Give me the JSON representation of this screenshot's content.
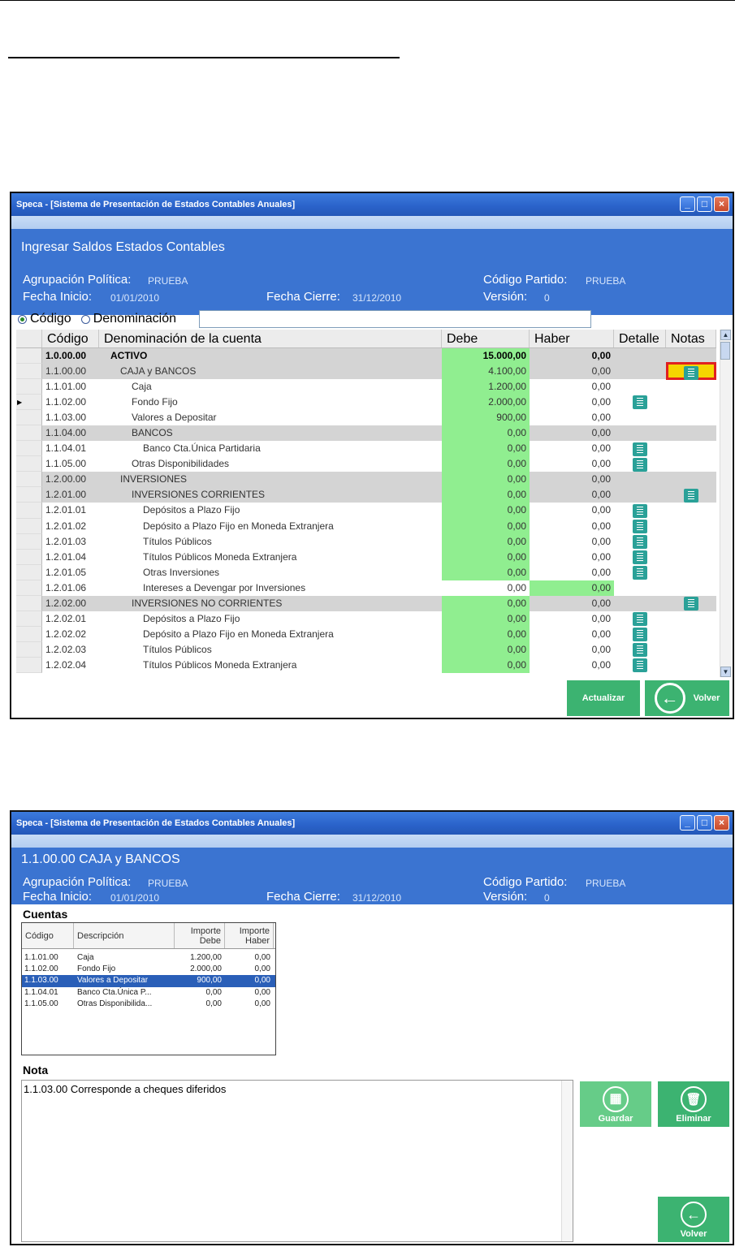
{
  "window1": {
    "title": "Speca - [Sistema de Presentación de Estados Contables Anuales]",
    "header_title": "Ingresar Saldos Estados Contables",
    "agrupacion_label": "Agrupación Política:",
    "agrupacion_value": "PRUEBA",
    "codigo_partido_label": "Código Partido:",
    "codigo_partido_value": "PRUEBA",
    "fecha_inicio_label": "Fecha Inicio:",
    "fecha_inicio_value": "01/01/2010",
    "fecha_cierre_label": "Fecha Cierre:",
    "fecha_cierre_value": "31/12/2010",
    "version_label": "Versión:",
    "version_value": "0",
    "radio_codigo": "Código",
    "radio_denominacion": "Denominación",
    "columns": [
      "Código",
      "Denominación de la cuenta",
      "Debe",
      "Haber",
      "Detalle",
      "Notas"
    ],
    "rows": [
      {
        "codigo": "1.0.00.00",
        "denominacion": "ACTIVO",
        "debe": "15.000,00",
        "haber": "0,00"
      },
      {
        "codigo": "1.1.00.00",
        "denominacion": "CAJA y BANCOS",
        "debe": "4.100,00",
        "haber": "0,00"
      },
      {
        "codigo": "1.1.01.00",
        "denominacion": "Caja",
        "debe": "1.200,00",
        "haber": "0,00"
      },
      {
        "codigo": "1.1.02.00",
        "denominacion": "Fondo Fijo",
        "debe": "2.000,00",
        "haber": "0,00"
      },
      {
        "codigo": "1.1.03.00",
        "denominacion": "Valores a Depositar",
        "debe": "900,00",
        "haber": "0,00"
      },
      {
        "codigo": "1.1.04.00",
        "denominacion": "BANCOS",
        "debe": "0,00",
        "haber": "0,00"
      },
      {
        "codigo": "1.1.04.01",
        "denominacion": "Banco Cta.Única Partidaria",
        "debe": "0,00",
        "haber": "0,00"
      },
      {
        "codigo": "1.1.05.00",
        "denominacion": "Otras Disponibilidades",
        "debe": "0,00",
        "haber": "0,00"
      },
      {
        "codigo": "1.2.00.00",
        "denominacion": "INVERSIONES",
        "debe": "0,00",
        "haber": "0,00"
      },
      {
        "codigo": "1.2.01.00",
        "denominacion": "INVERSIONES CORRIENTES",
        "debe": "0,00",
        "haber": "0,00"
      },
      {
        "codigo": "1.2.01.01",
        "denominacion": "Depósitos a Plazo Fijo",
        "debe": "0,00",
        "haber": "0,00"
      },
      {
        "codigo": "1.2.01.02",
        "denominacion": "Depósito a Plazo Fijo en Moneda Extranjera",
        "debe": "0,00",
        "haber": "0,00"
      },
      {
        "codigo": "1.2.01.03",
        "denominacion": "Títulos Públicos",
        "debe": "0,00",
        "haber": "0,00"
      },
      {
        "codigo": "1.2.01.04",
        "denominacion": "Títulos Públicos Moneda Extranjera",
        "debe": "0,00",
        "haber": "0,00"
      },
      {
        "codigo": "1.2.01.05",
        "denominacion": "Otras Inversiones",
        "debe": "0,00",
        "haber": "0,00"
      },
      {
        "codigo": "1.2.01.06",
        "denominacion": "Intereses a Devengar por Inversiones",
        "debe": "0,00",
        "haber": "0,00"
      },
      {
        "codigo": "1.2.02.00",
        "denominacion": "INVERSIONES NO CORRIENTES",
        "debe": "0,00",
        "haber": "0,00"
      },
      {
        "codigo": "1.2.02.01",
        "denominacion": "Depósitos a Plazo Fijo",
        "debe": "0,00",
        "haber": "0,00"
      },
      {
        "codigo": "1.2.02.02",
        "denominacion": "Depósito a Plazo Fijo en Moneda Extranjera",
        "debe": "0,00",
        "haber": "0,00"
      },
      {
        "codigo": "1.2.02.03",
        "denominacion": "Títulos Públicos",
        "debe": "0,00",
        "haber": "0,00"
      },
      {
        "codigo": "1.2.02.04",
        "denominacion": "Títulos Públicos Moneda Extranjera",
        "debe": "0,00",
        "haber": "0,00"
      }
    ],
    "actualizar_label": "Actualizar",
    "volver_label": "Volver"
  },
  "window2": {
    "title": "Speca - [Sistema de Presentación de Estados Contables Anuales]",
    "header_title": "1.1.00.00 CAJA y BANCOS",
    "agrupacion_label": "Agrupación Política:",
    "agrupacion_value": "PRUEBA",
    "codigo_partido_label": "Código Partido:",
    "codigo_partido_value": "PRUEBA",
    "fecha_inicio_label": "Fecha Inicio:",
    "fecha_inicio_value": "01/01/2010",
    "fecha_cierre_label": "Fecha Cierre:",
    "fecha_cierre_value": "31/12/2010",
    "version_label": "Versión:",
    "version_value": "0",
    "cuentas_label": "Cuentas",
    "list_headers": {
      "codigo": "Código",
      "descripcion": "Descripción",
      "importe_debe": "Importe Debe",
      "importe_haber": "Importe Haber"
    },
    "list_rows": [
      {
        "codigo": "1.1.01.00",
        "descripcion": "Caja",
        "debe": "1.200,00",
        "haber": "0,00"
      },
      {
        "codigo": "1.1.02.00",
        "descripcion": "Fondo Fijo",
        "debe": "2.000,00",
        "haber": "0,00"
      },
      {
        "codigo": "1.1.03.00",
        "descripcion": "Valores a Depositar",
        "debe": "900,00",
        "haber": "0,00"
      },
      {
        "codigo": "1.1.04.01",
        "descripcion": "Banco Cta.Única P...",
        "debe": "0,00",
        "haber": "0,00"
      },
      {
        "codigo": "1.1.05.00",
        "descripcion": "Otras Disponibilida...",
        "debe": "0,00",
        "haber": "0,00"
      }
    ],
    "nota_label": "Nota",
    "nota_text": "1.1.03.00 Corresponde a cheques diferidos",
    "guardar_label": "Guardar",
    "eliminar_label": "Eliminar",
    "volver_label": "Volver"
  },
  "colors": {
    "header_blue": "#3b74d1",
    "debe_green": "#90ee90",
    "button_green": "#3cb371",
    "note_icon": "#2aa198",
    "highlight_yellow": "#f5d500",
    "highlight_border": "#e02020"
  }
}
